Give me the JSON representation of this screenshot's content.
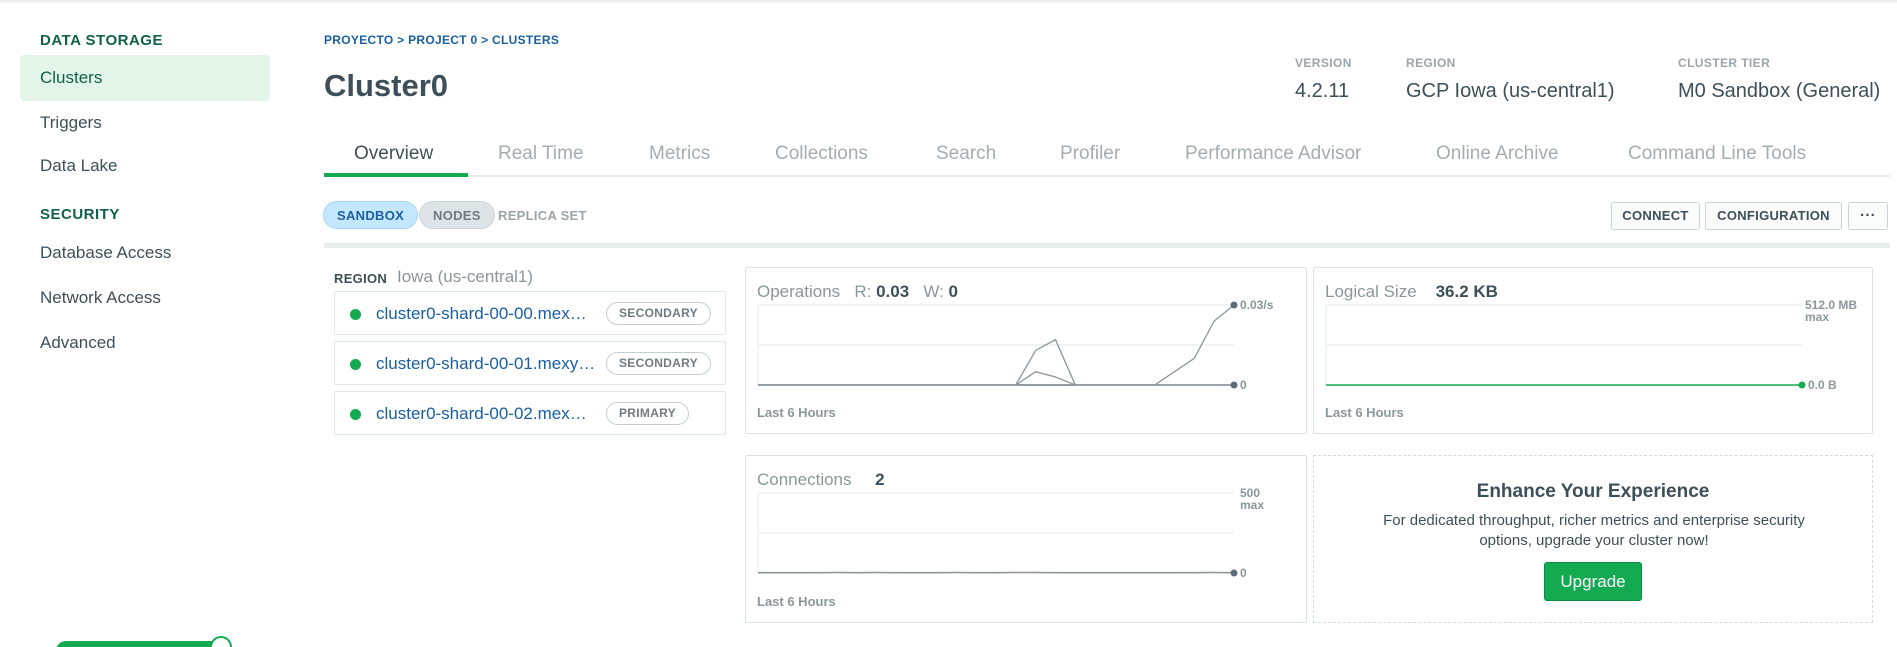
{
  "sidebar": {
    "sections": [
      {
        "title": "DATA STORAGE"
      },
      {
        "title": "SECURITY"
      }
    ],
    "items": [
      {
        "label": "Clusters"
      },
      {
        "label": "Triggers"
      },
      {
        "label": "Data Lake"
      },
      {
        "label": "Database Access"
      },
      {
        "label": "Network Access"
      },
      {
        "label": "Advanced"
      }
    ]
  },
  "header": {
    "breadcrumb": "PROYECTO > PROJECT 0 > CLUSTERS",
    "title": "Cluster0",
    "version_label": "VERSION",
    "version": "4.2.11",
    "region_label": "REGION",
    "region": "GCP Iowa (us-central1)",
    "tier_label": "CLUSTER TIER",
    "tier": "M0 Sandbox (General)"
  },
  "tabs": [
    {
      "label": "Overview"
    },
    {
      "label": "Real Time"
    },
    {
      "label": "Metrics"
    },
    {
      "label": "Collections"
    },
    {
      "label": "Search"
    },
    {
      "label": "Profiler"
    },
    {
      "label": "Performance Advisor"
    },
    {
      "label": "Online Archive"
    },
    {
      "label": "Command Line Tools"
    }
  ],
  "badges": {
    "sandbox": "SANDBOX",
    "nodes": "NODES",
    "replica": "REPLICA SET"
  },
  "actions": {
    "connect": "CONNECT",
    "configuration": "CONFIGURATION",
    "more": "···"
  },
  "region_panel": {
    "label": "REGION",
    "value": "Iowa (us-central1)",
    "nodes": [
      {
        "host": "cluster0-shard-00-00.mex…",
        "role": "SECONDARY",
        "status_color": "#13aa52"
      },
      {
        "host": "cluster0-shard-00-01.mexy…",
        "role": "SECONDARY",
        "status_color": "#13aa52"
      },
      {
        "host": "cluster0-shard-00-02.mex…",
        "role": "PRIMARY",
        "status_color": "#13aa52"
      }
    ]
  },
  "charts": {
    "operations": {
      "title": "Operations",
      "r_label": "R:",
      "r_value": "0.03",
      "w_label": "W:",
      "w_value": "0",
      "y_top": "0.03/s",
      "y_bottom": "0",
      "footer": "Last 6 Hours"
    },
    "logical": {
      "title": "Logical Size",
      "value": "36.2 KB",
      "y_top": "512.0 MB",
      "y_top_sub": "max",
      "y_bottom": "0.0 B",
      "footer": "Last 6 Hours"
    },
    "connections": {
      "title": "Connections",
      "value": "2",
      "y_top": "500",
      "y_top_sub": "max",
      "y_bottom": "0",
      "footer": "Last 6 Hours"
    }
  },
  "chart_data": [
    {
      "type": "line",
      "title": "Operations",
      "ylim": [
        0,
        0.03
      ],
      "series": [
        {
          "name": "R",
          "values": [
            0,
            0,
            0,
            0,
            0,
            0,
            0,
            0,
            0,
            0,
            0,
            0,
            0,
            0,
            0.013,
            0.017,
            0,
            0,
            0,
            0,
            0,
            0.005,
            0.01,
            0.024,
            0.03
          ]
        },
        {
          "name": "W",
          "values": [
            0,
            0,
            0,
            0,
            0,
            0,
            0,
            0,
            0,
            0,
            0,
            0,
            0,
            0,
            0.005,
            0.003,
            0,
            0,
            0,
            0,
            0,
            0,
            0,
            0,
            0
          ]
        }
      ]
    },
    {
      "type": "line",
      "title": "Logical Size",
      "ylim": [
        0,
        512
      ],
      "series": [
        {
          "values": [
            0,
            0,
            0,
            0,
            0,
            0,
            0,
            0,
            0,
            0,
            0,
            0
          ]
        }
      ]
    },
    {
      "type": "line",
      "title": "Connections",
      "ylim": [
        0,
        500
      ],
      "series": [
        {
          "values": [
            2,
            2,
            2,
            2,
            3,
            2,
            3,
            2,
            2,
            2,
            3,
            2,
            2,
            3,
            3,
            2,
            2,
            2,
            2,
            2,
            2,
            2,
            2,
            3,
            2
          ]
        }
      ]
    }
  ],
  "upsell": {
    "title": "Enhance Your Experience",
    "text": "For dedicated throughput, richer metrics and enterprise security options, upgrade your cluster now!",
    "button": "Upgrade"
  },
  "colors": {
    "accent": "#13aa52",
    "link": "#1a5fa0",
    "active_bg": "#e3f4e8"
  }
}
